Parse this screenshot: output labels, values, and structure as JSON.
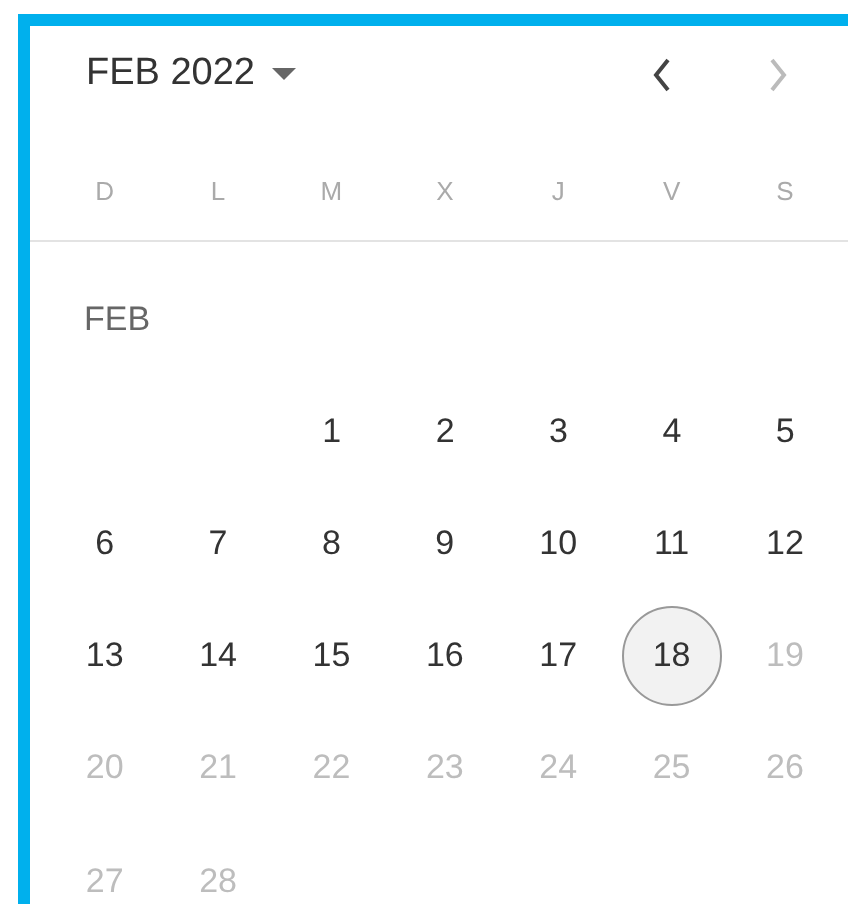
{
  "header": {
    "title": "FEB 2022",
    "prev": {
      "disabled": false
    },
    "next": {
      "disabled": true
    }
  },
  "weekdays": [
    "D",
    "L",
    "M",
    "X",
    "J",
    "V",
    "S"
  ],
  "month_label": "FEB",
  "weeks": [
    [
      {
        "day": "1",
        "disabled": false,
        "selected": false
      },
      {
        "day": "2",
        "disabled": false,
        "selected": false
      },
      {
        "day": "3",
        "disabled": false,
        "selected": false
      },
      {
        "day": "4",
        "disabled": false,
        "selected": false
      },
      {
        "day": "5",
        "disabled": false,
        "selected": false
      }
    ],
    [
      {
        "day": "6",
        "disabled": false,
        "selected": false
      },
      {
        "day": "7",
        "disabled": false,
        "selected": false
      },
      {
        "day": "8",
        "disabled": false,
        "selected": false
      },
      {
        "day": "9",
        "disabled": false,
        "selected": false
      },
      {
        "day": "10",
        "disabled": false,
        "selected": false
      },
      {
        "day": "11",
        "disabled": false,
        "selected": false
      },
      {
        "day": "12",
        "disabled": false,
        "selected": false
      }
    ],
    [
      {
        "day": "13",
        "disabled": false,
        "selected": false
      },
      {
        "day": "14",
        "disabled": false,
        "selected": false
      },
      {
        "day": "15",
        "disabled": false,
        "selected": false
      },
      {
        "day": "16",
        "disabled": false,
        "selected": false
      },
      {
        "day": "17",
        "disabled": false,
        "selected": false
      },
      {
        "day": "18",
        "disabled": false,
        "selected": true
      },
      {
        "day": "19",
        "disabled": true,
        "selected": false
      }
    ],
    [
      {
        "day": "20",
        "disabled": true,
        "selected": false
      },
      {
        "day": "21",
        "disabled": true,
        "selected": false
      },
      {
        "day": "22",
        "disabled": true,
        "selected": false
      },
      {
        "day": "23",
        "disabled": true,
        "selected": false
      },
      {
        "day": "24",
        "disabled": true,
        "selected": false
      },
      {
        "day": "25",
        "disabled": true,
        "selected": false
      },
      {
        "day": "26",
        "disabled": true,
        "selected": false
      }
    ],
    [
      {
        "day": "27",
        "disabled": true,
        "selected": false
      },
      {
        "day": "28",
        "disabled": true,
        "selected": false
      }
    ]
  ]
}
